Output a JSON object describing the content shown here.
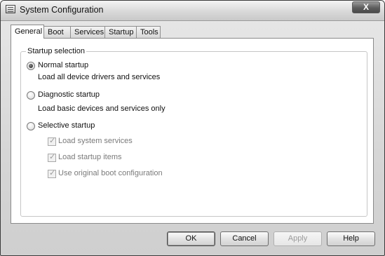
{
  "window": {
    "title": "System Configuration",
    "close_label": "X"
  },
  "tabs": [
    {
      "label": "General",
      "active": true
    },
    {
      "label": "Boot"
    },
    {
      "label": "Services"
    },
    {
      "label": "Startup"
    },
    {
      "label": "Tools"
    }
  ],
  "startup_selection": {
    "group_label": "Startup selection",
    "options": [
      {
        "label": "Normal startup",
        "description": "Load all device drivers and services",
        "selected": true
      },
      {
        "label": "Diagnostic startup",
        "description": "Load basic devices and services only",
        "selected": false
      },
      {
        "label": "Selective startup",
        "selected": false
      }
    ],
    "selective_items": [
      {
        "label": "Load system services",
        "checked": true,
        "enabled": false
      },
      {
        "label": "Load startup items",
        "checked": true,
        "enabled": false
      },
      {
        "label": "Use original boot configuration",
        "checked": true,
        "enabled": false
      }
    ]
  },
  "buttons": {
    "ok": "OK",
    "cancel": "Cancel",
    "apply": "Apply",
    "help": "Help"
  }
}
